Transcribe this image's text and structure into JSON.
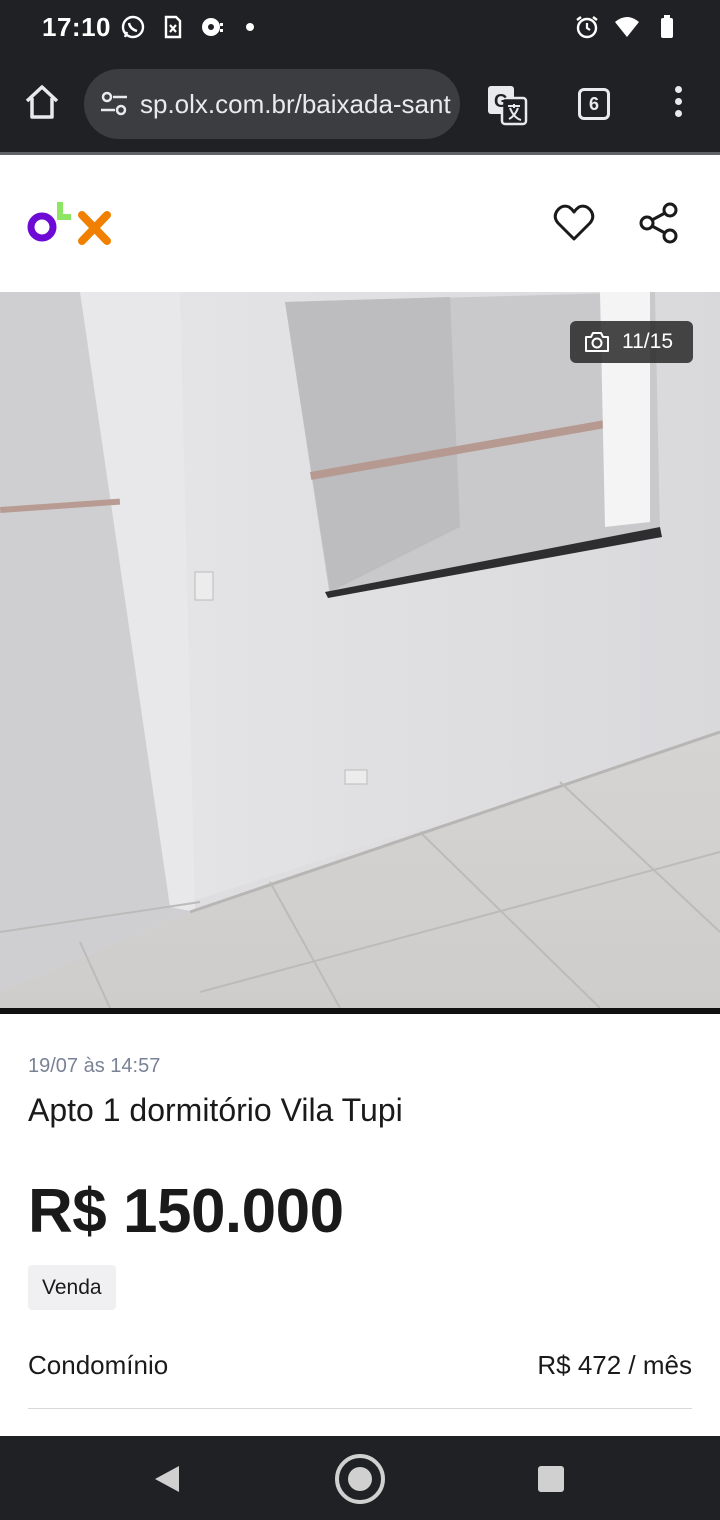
{
  "status_bar": {
    "time": "17:10",
    "left_icons": [
      "whatsapp-icon",
      "sim-card-icon",
      "music-notification-icon",
      "dot-icon"
    ],
    "right_icons": [
      "alarm-icon",
      "wifi-icon",
      "battery-icon"
    ]
  },
  "browser": {
    "url": "sp.olx.com.br/baixada-santista",
    "tab_count": "6",
    "icons": [
      "home-icon",
      "tune-icon",
      "translate-icon",
      "more-vert-icon"
    ]
  },
  "site_header": {
    "logo_letters": [
      "o",
      "L",
      "x"
    ],
    "logo_colors": [
      "#6e0ad6",
      "#8ce563",
      "#f28000"
    ],
    "icons": [
      "heart-icon",
      "share-icon"
    ]
  },
  "gallery": {
    "counter": "11/15",
    "icon": "camera-icon"
  },
  "ad": {
    "date": "19/07 às 14:57",
    "title": "Apto 1 dormitório Vila Tupi",
    "price": "R$ 150.000",
    "badge": "Venda",
    "condominio_label": "Condomínio",
    "condominio_value": "R$ 472 / mês"
  },
  "colors": {
    "system_bar": "#202124",
    "text_primary": "#1a1a1a",
    "text_muted": "#7a8296"
  }
}
